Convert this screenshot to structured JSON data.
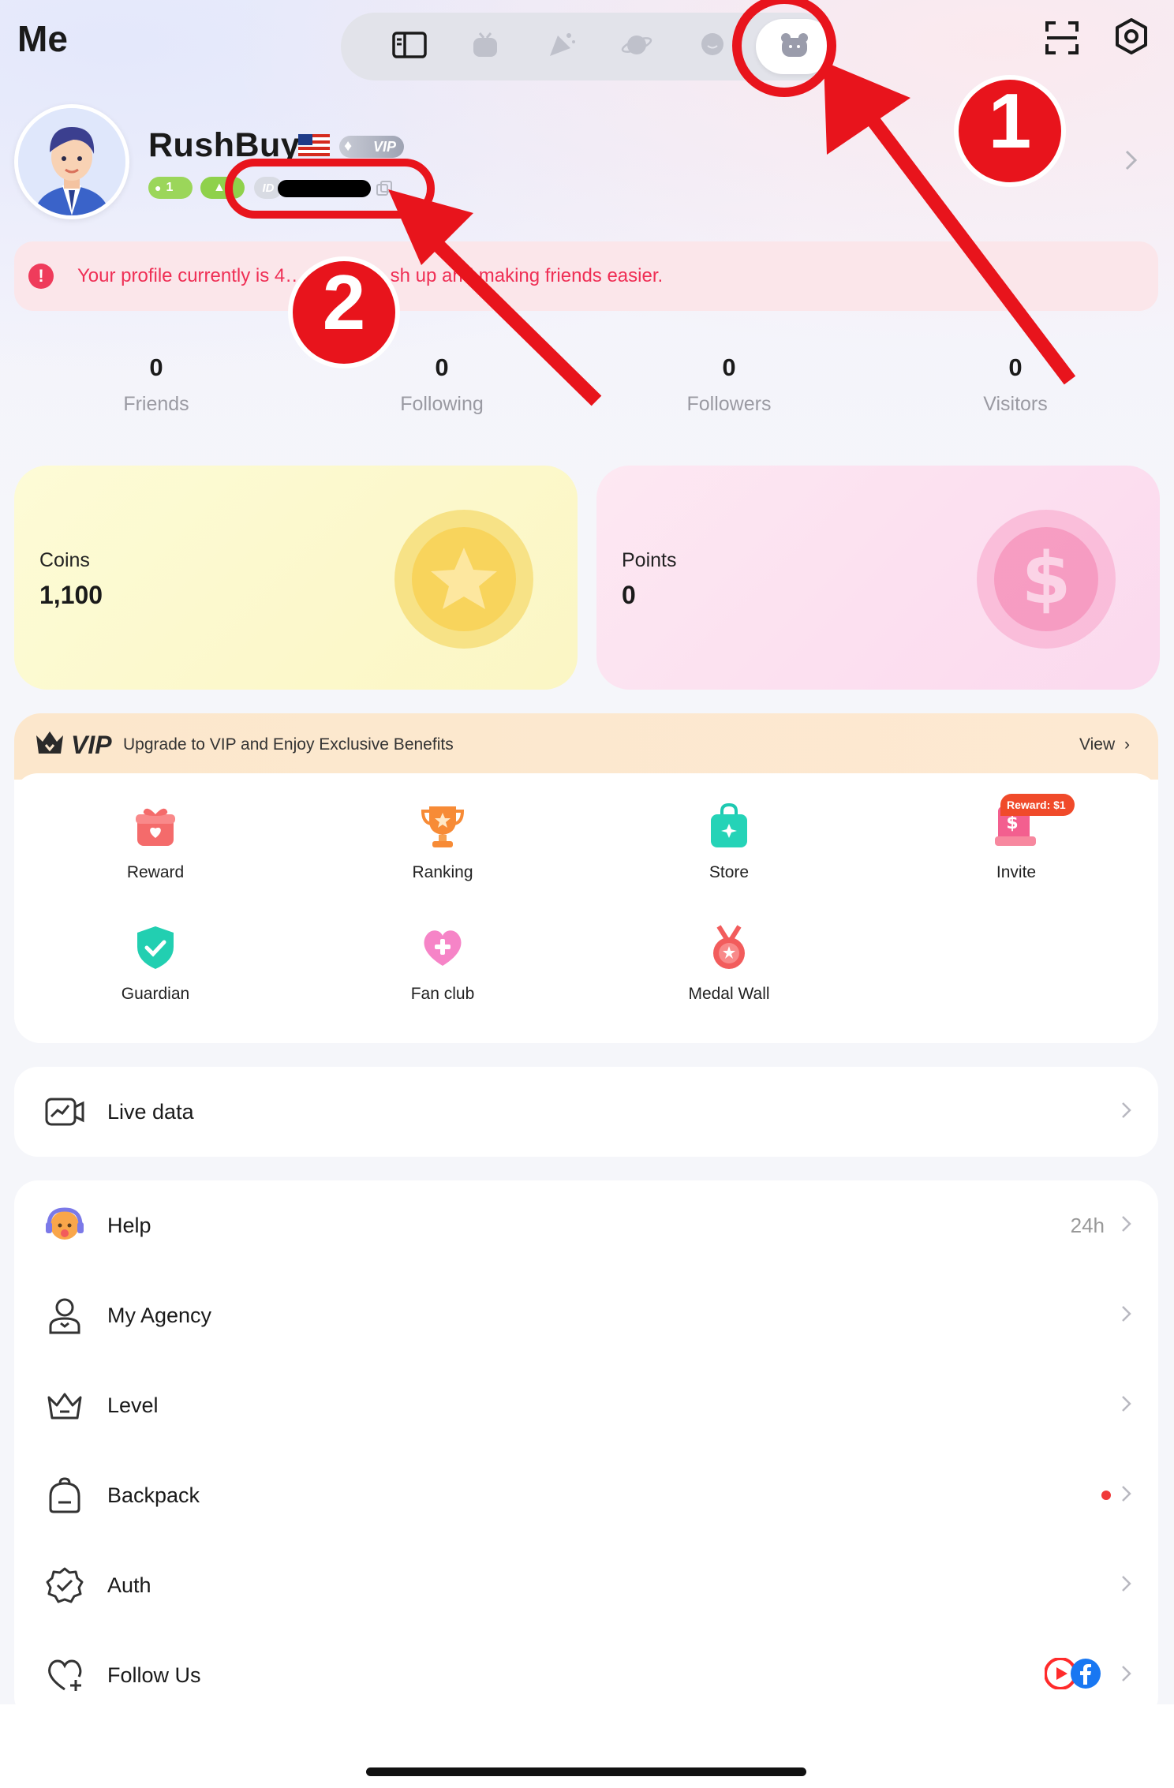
{
  "header": {
    "title": "Me",
    "tabs": [
      {
        "icon": "sidebar-panel-icon"
      },
      {
        "icon": "tv-icon"
      },
      {
        "icon": "party-icon"
      },
      {
        "icon": "planet-icon"
      },
      {
        "icon": "chat-bubble-icon"
      },
      {
        "icon": "me-bear-icon",
        "active": true
      }
    ],
    "scan_icon": "scan-icon",
    "settings_icon": "settings-icon"
  },
  "profile": {
    "name": "RushBuy",
    "flag": "us-flag-icon",
    "vip_tag": "VIP",
    "level_badges": [
      "1",
      "▲"
    ],
    "id_prefix": "ID"
  },
  "notice": {
    "text": "Your profile currently is 4… leted, p…sh up and making friends easier."
  },
  "stats": [
    {
      "value": "0",
      "label": "Friends"
    },
    {
      "value": "0",
      "label": "Following"
    },
    {
      "value": "0",
      "label": "Followers"
    },
    {
      "value": "0",
      "label": "Visitors"
    }
  ],
  "wallet": {
    "coins": {
      "label": "Coins",
      "value": "1,100"
    },
    "points": {
      "label": "Points",
      "value": "0"
    }
  },
  "vip": {
    "logo": "VIP",
    "description": "Upgrade to VIP and Enjoy Exclusive Benefits",
    "view": "View",
    "reward_tag": "Reward: $1",
    "features": [
      {
        "label": "Reward",
        "icon": "gift-box-icon"
      },
      {
        "label": "Ranking",
        "icon": "trophy-icon"
      },
      {
        "label": "Store",
        "icon": "shopping-bag-icon"
      },
      {
        "label": "Invite",
        "icon": "invite-icon"
      },
      {
        "label": "Guardian",
        "icon": "shield-check-icon"
      },
      {
        "label": "Fan club",
        "icon": "heart-plus-icon"
      },
      {
        "label": "Medal Wall",
        "icon": "medal-icon"
      }
    ]
  },
  "menu_single": {
    "label": "Live data",
    "icon": "live-data-icon"
  },
  "menu": [
    {
      "label": "Help",
      "icon": "support-agent-icon",
      "meta": "24h"
    },
    {
      "label": "My Agency",
      "icon": "agency-person-icon"
    },
    {
      "label": "Level",
      "icon": "crown-level-icon"
    },
    {
      "label": "Backpack",
      "icon": "backpack-icon",
      "dot": true
    },
    {
      "label": "Auth",
      "icon": "verified-badge-icon"
    },
    {
      "label": "Follow Us",
      "icon": "heart-add-icon",
      "social": [
        "youtube-icon",
        "facebook-icon"
      ]
    }
  ],
  "annotations": [
    "1",
    "2"
  ],
  "colors": {
    "accent_red": "#e8141c",
    "notice_text": "#ef2f55",
    "coin_yellow": "#f7d94c",
    "points_pink": "#f58fb8",
    "vip_header": "#fce7cc"
  }
}
